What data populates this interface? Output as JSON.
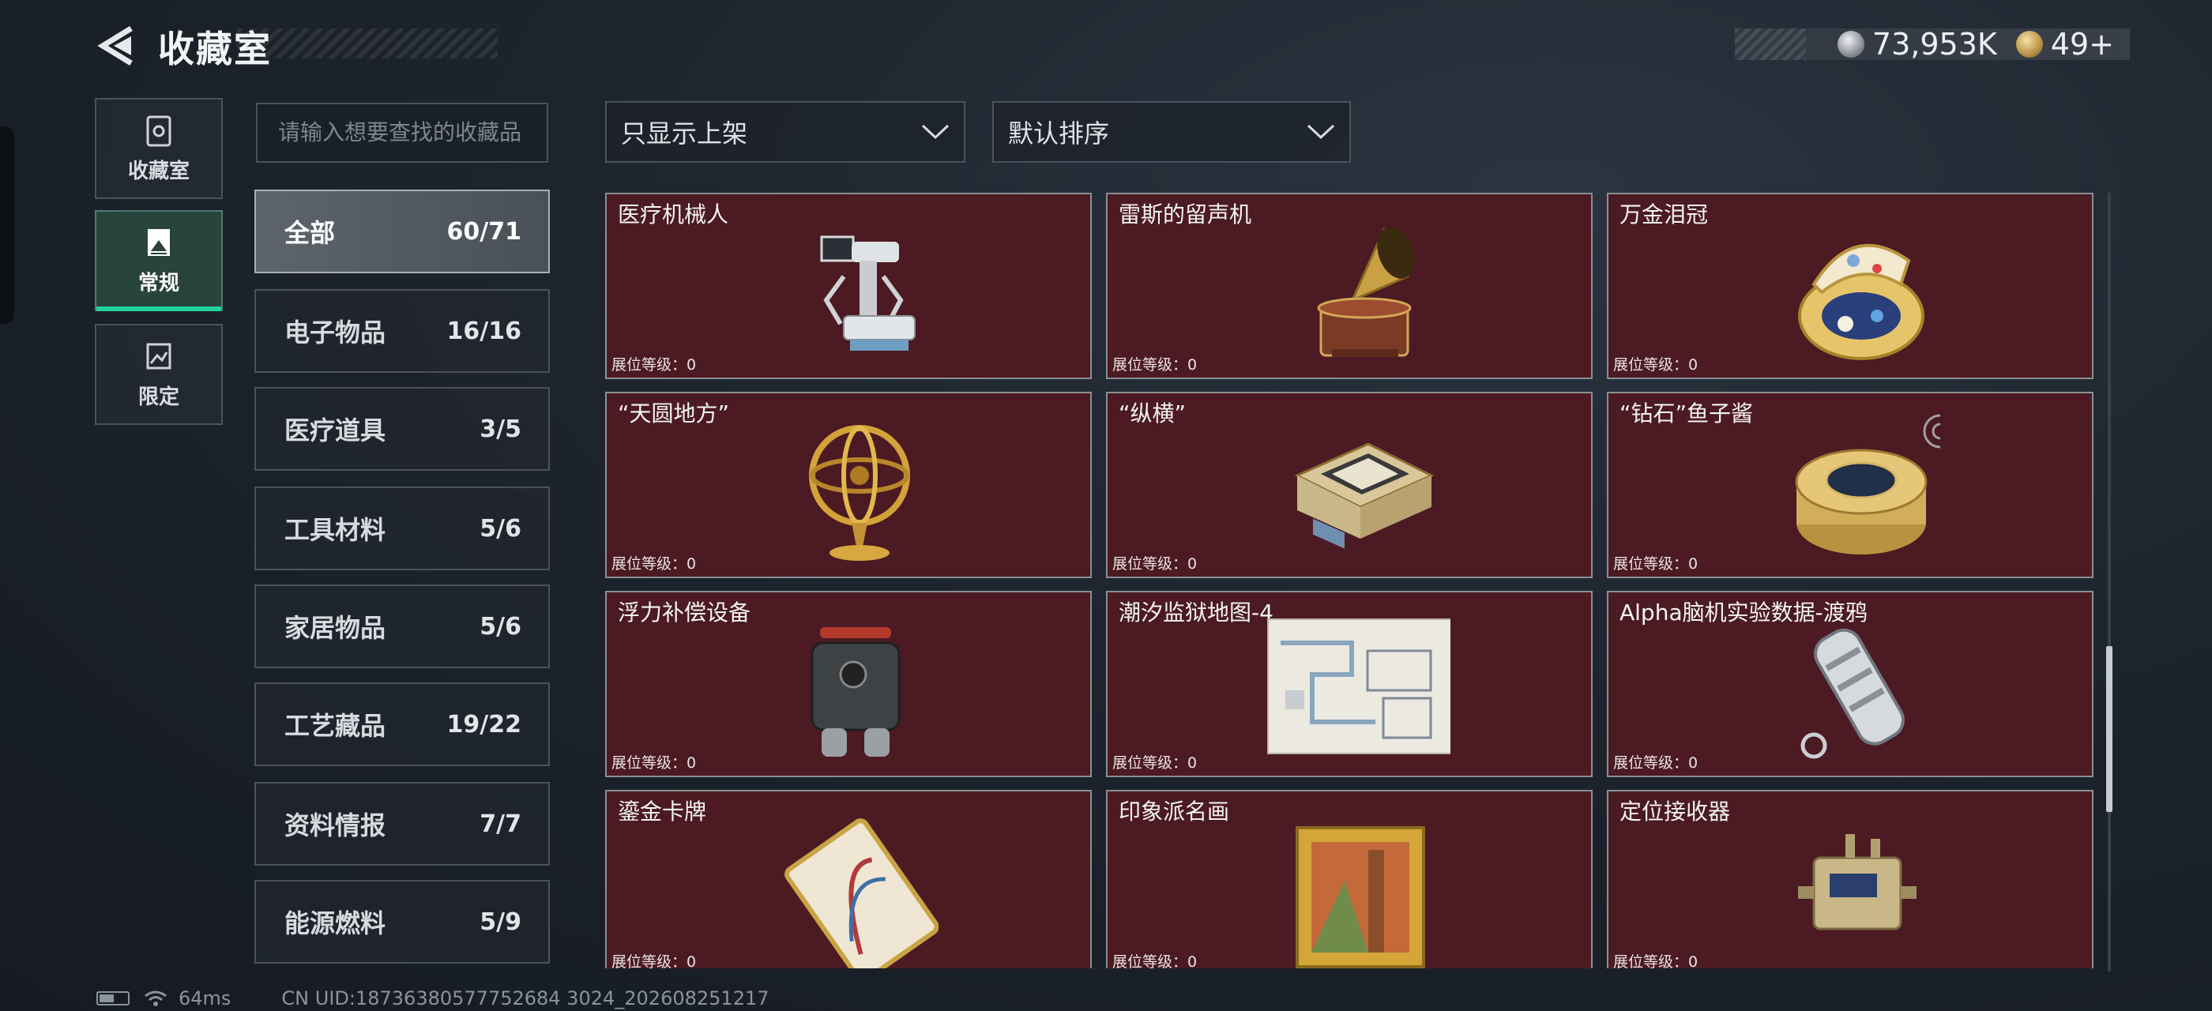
{
  "header": {
    "title": "收藏室",
    "currency": [
      {
        "icon": "silver-coin-icon",
        "value": "73,953K"
      },
      {
        "icon": "gold-coin-icon",
        "value": "49+"
      }
    ]
  },
  "modes": [
    {
      "label": "收藏室",
      "icon": "cabinet-icon",
      "active": false
    },
    {
      "label": "常规",
      "icon": "picture-icon",
      "active": true
    },
    {
      "label": "限定",
      "icon": "limited-icon",
      "active": false
    }
  ],
  "search": {
    "placeholder": "请输入想要查找的收藏品"
  },
  "filters": {
    "shelf": "只显示上架",
    "sort": "默认排序"
  },
  "categories": [
    {
      "name": "全部",
      "count": "60/71",
      "active": true
    },
    {
      "name": "电子物品",
      "count": "16/16"
    },
    {
      "name": "医疗道具",
      "count": "3/5"
    },
    {
      "name": "工具材料",
      "count": "5/6"
    },
    {
      "name": "家居物品",
      "count": "5/6"
    },
    {
      "name": "工艺藏品",
      "count": "19/22"
    },
    {
      "name": "资料情报",
      "count": "7/7"
    },
    {
      "name": "能源燃料",
      "count": "5/9"
    }
  ],
  "items": [
    {
      "name": "医疗机械人",
      "level": "展位等级：0",
      "art": "medical-robot-icon"
    },
    {
      "name": "雷斯的留声机",
      "level": "展位等级：0",
      "art": "gramophone-icon"
    },
    {
      "name": "万金泪冠",
      "level": "展位等级：0",
      "art": "jeweled-egg-icon"
    },
    {
      "name": "“天圆地方”",
      "level": "展位等级：0",
      "art": "armillary-sphere-icon"
    },
    {
      "name": "“纵横”",
      "level": "展位等级：0",
      "art": "chess-box-icon"
    },
    {
      "name": "“钻石”鱼子酱",
      "level": "展位等级：0",
      "art": "caviar-tin-icon"
    },
    {
      "name": "浮力补偿设备",
      "level": "展位等级：0",
      "art": "buoyancy-device-icon"
    },
    {
      "name": "潮汐监狱地图-4",
      "level": "展位等级：0",
      "art": "prison-map-icon"
    },
    {
      "name": "Alpha脑机实验数据-渡鸦",
      "level": "展位等级：0",
      "art": "data-capsule-icon"
    },
    {
      "name": "鎏金卡牌",
      "level": "展位等级：0",
      "art": "gilded-card-icon"
    },
    {
      "name": "印象派名画",
      "level": "展位等级：0",
      "art": "painting-icon"
    },
    {
      "name": "定位接收器",
      "level": "展位等级：0",
      "art": "receiver-icon"
    }
  ],
  "status": {
    "ping": "64ms",
    "uid": "CN UID:18736380577752684 3024_202608251217"
  }
}
